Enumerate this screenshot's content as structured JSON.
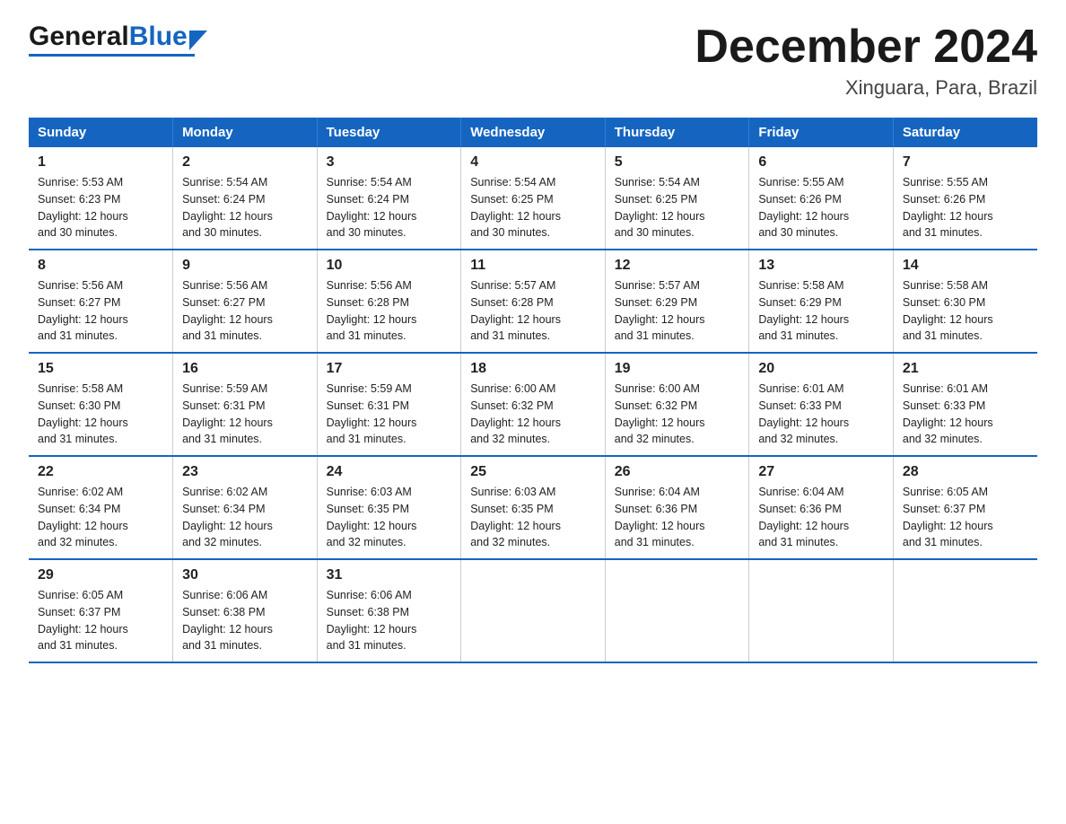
{
  "header": {
    "logo_general": "General",
    "logo_blue": "Blue",
    "main_title": "December 2024",
    "subtitle": "Xinguara, Para, Brazil"
  },
  "days_of_week": [
    "Sunday",
    "Monday",
    "Tuesday",
    "Wednesday",
    "Thursday",
    "Friday",
    "Saturday"
  ],
  "weeks": [
    [
      {
        "num": "1",
        "info": "Sunrise: 5:53 AM\nSunset: 6:23 PM\nDaylight: 12 hours\nand 30 minutes."
      },
      {
        "num": "2",
        "info": "Sunrise: 5:54 AM\nSunset: 6:24 PM\nDaylight: 12 hours\nand 30 minutes."
      },
      {
        "num": "3",
        "info": "Sunrise: 5:54 AM\nSunset: 6:24 PM\nDaylight: 12 hours\nand 30 minutes."
      },
      {
        "num": "4",
        "info": "Sunrise: 5:54 AM\nSunset: 6:25 PM\nDaylight: 12 hours\nand 30 minutes."
      },
      {
        "num": "5",
        "info": "Sunrise: 5:54 AM\nSunset: 6:25 PM\nDaylight: 12 hours\nand 30 minutes."
      },
      {
        "num": "6",
        "info": "Sunrise: 5:55 AM\nSunset: 6:26 PM\nDaylight: 12 hours\nand 30 minutes."
      },
      {
        "num": "7",
        "info": "Sunrise: 5:55 AM\nSunset: 6:26 PM\nDaylight: 12 hours\nand 31 minutes."
      }
    ],
    [
      {
        "num": "8",
        "info": "Sunrise: 5:56 AM\nSunset: 6:27 PM\nDaylight: 12 hours\nand 31 minutes."
      },
      {
        "num": "9",
        "info": "Sunrise: 5:56 AM\nSunset: 6:27 PM\nDaylight: 12 hours\nand 31 minutes."
      },
      {
        "num": "10",
        "info": "Sunrise: 5:56 AM\nSunset: 6:28 PM\nDaylight: 12 hours\nand 31 minutes."
      },
      {
        "num": "11",
        "info": "Sunrise: 5:57 AM\nSunset: 6:28 PM\nDaylight: 12 hours\nand 31 minutes."
      },
      {
        "num": "12",
        "info": "Sunrise: 5:57 AM\nSunset: 6:29 PM\nDaylight: 12 hours\nand 31 minutes."
      },
      {
        "num": "13",
        "info": "Sunrise: 5:58 AM\nSunset: 6:29 PM\nDaylight: 12 hours\nand 31 minutes."
      },
      {
        "num": "14",
        "info": "Sunrise: 5:58 AM\nSunset: 6:30 PM\nDaylight: 12 hours\nand 31 minutes."
      }
    ],
    [
      {
        "num": "15",
        "info": "Sunrise: 5:58 AM\nSunset: 6:30 PM\nDaylight: 12 hours\nand 31 minutes."
      },
      {
        "num": "16",
        "info": "Sunrise: 5:59 AM\nSunset: 6:31 PM\nDaylight: 12 hours\nand 31 minutes."
      },
      {
        "num": "17",
        "info": "Sunrise: 5:59 AM\nSunset: 6:31 PM\nDaylight: 12 hours\nand 31 minutes."
      },
      {
        "num": "18",
        "info": "Sunrise: 6:00 AM\nSunset: 6:32 PM\nDaylight: 12 hours\nand 32 minutes."
      },
      {
        "num": "19",
        "info": "Sunrise: 6:00 AM\nSunset: 6:32 PM\nDaylight: 12 hours\nand 32 minutes."
      },
      {
        "num": "20",
        "info": "Sunrise: 6:01 AM\nSunset: 6:33 PM\nDaylight: 12 hours\nand 32 minutes."
      },
      {
        "num": "21",
        "info": "Sunrise: 6:01 AM\nSunset: 6:33 PM\nDaylight: 12 hours\nand 32 minutes."
      }
    ],
    [
      {
        "num": "22",
        "info": "Sunrise: 6:02 AM\nSunset: 6:34 PM\nDaylight: 12 hours\nand 32 minutes."
      },
      {
        "num": "23",
        "info": "Sunrise: 6:02 AM\nSunset: 6:34 PM\nDaylight: 12 hours\nand 32 minutes."
      },
      {
        "num": "24",
        "info": "Sunrise: 6:03 AM\nSunset: 6:35 PM\nDaylight: 12 hours\nand 32 minutes."
      },
      {
        "num": "25",
        "info": "Sunrise: 6:03 AM\nSunset: 6:35 PM\nDaylight: 12 hours\nand 32 minutes."
      },
      {
        "num": "26",
        "info": "Sunrise: 6:04 AM\nSunset: 6:36 PM\nDaylight: 12 hours\nand 31 minutes."
      },
      {
        "num": "27",
        "info": "Sunrise: 6:04 AM\nSunset: 6:36 PM\nDaylight: 12 hours\nand 31 minutes."
      },
      {
        "num": "28",
        "info": "Sunrise: 6:05 AM\nSunset: 6:37 PM\nDaylight: 12 hours\nand 31 minutes."
      }
    ],
    [
      {
        "num": "29",
        "info": "Sunrise: 6:05 AM\nSunset: 6:37 PM\nDaylight: 12 hours\nand 31 minutes."
      },
      {
        "num": "30",
        "info": "Sunrise: 6:06 AM\nSunset: 6:38 PM\nDaylight: 12 hours\nand 31 minutes."
      },
      {
        "num": "31",
        "info": "Sunrise: 6:06 AM\nSunset: 6:38 PM\nDaylight: 12 hours\nand 31 minutes."
      },
      {
        "num": "",
        "info": ""
      },
      {
        "num": "",
        "info": ""
      },
      {
        "num": "",
        "info": ""
      },
      {
        "num": "",
        "info": ""
      }
    ]
  ]
}
